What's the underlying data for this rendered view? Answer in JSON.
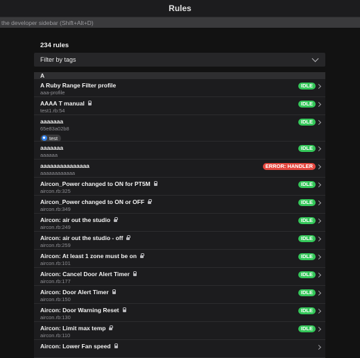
{
  "window": {
    "title": "Rules"
  },
  "hint": "the developer sidebar (Shift+Alt+D)",
  "rules_count": "234 rules",
  "filter": {
    "label": "Filter by tags"
  },
  "section": "A",
  "colors": {
    "idle": "#34c759",
    "error": "#e5473f",
    "tag_icon": "#2f7fe8"
  },
  "rules": [
    {
      "title": "A Ruby Range Filter profile",
      "sub": "aaa-profile",
      "lock": false,
      "status": "IDLE",
      "status_type": "idle"
    },
    {
      "title": "AAAA T manual",
      "sub": "test1.rb:54",
      "lock": true,
      "status": "IDLE",
      "status_type": "idle"
    },
    {
      "title": "aaaaaaa",
      "sub": "65e83a02b8",
      "lock": false,
      "status": "IDLE",
      "status_type": "idle",
      "tag": "test"
    },
    {
      "title": "aaaaaaa",
      "sub": "aaaaaa",
      "lock": false,
      "status": "IDLE",
      "status_type": "idle"
    },
    {
      "title": "aaaaaaaaaaaaaaa",
      "sub": "aaaaaaaaaaaa",
      "lock": false,
      "status": "ERROR: HANDLER",
      "status_type": "error"
    },
    {
      "title": "Aircon_Power changed to ON for PT5M",
      "sub": "aircon.rb:325",
      "lock": true,
      "status": "IDLE",
      "status_type": "idle"
    },
    {
      "title": "Aircon_Power changed to ON or OFF",
      "sub": "aircon.rb:349",
      "lock": true,
      "status": "IDLE",
      "status_type": "idle"
    },
    {
      "title": "Aircon: air out the studio",
      "sub": "aircon.rb:249",
      "lock": true,
      "status": "IDLE",
      "status_type": "idle"
    },
    {
      "title": "Aircon: air out the studio - off",
      "sub": "aircon.rb:259",
      "lock": true,
      "status": "IDLE",
      "status_type": "idle"
    },
    {
      "title": "Aircon: At least 1 zone must be on",
      "sub": "aircon.rb:101",
      "lock": true,
      "status": "IDLE",
      "status_type": "idle"
    },
    {
      "title": "Aircon: Cancel Door Alert Timer",
      "sub": "aircon.rb:177",
      "lock": true,
      "status": "IDLE",
      "status_type": "idle"
    },
    {
      "title": "Aircon: Door Alert Timer",
      "sub": "aircon.rb:150",
      "lock": true,
      "status": "IDLE",
      "status_type": "idle"
    },
    {
      "title": "Aircon: Door Warning Reset",
      "sub": "aircon.rb:130",
      "lock": true,
      "status": "IDLE",
      "status_type": "idle"
    },
    {
      "title": "Aircon: Limit max temp",
      "sub": "aircon.rb:110",
      "lock": true,
      "status": "IDLE",
      "status_type": "idle"
    },
    {
      "title": "Aircon: Lower Fan speed",
      "sub": "",
      "lock": true,
      "status": "",
      "status_type": "idle"
    }
  ]
}
